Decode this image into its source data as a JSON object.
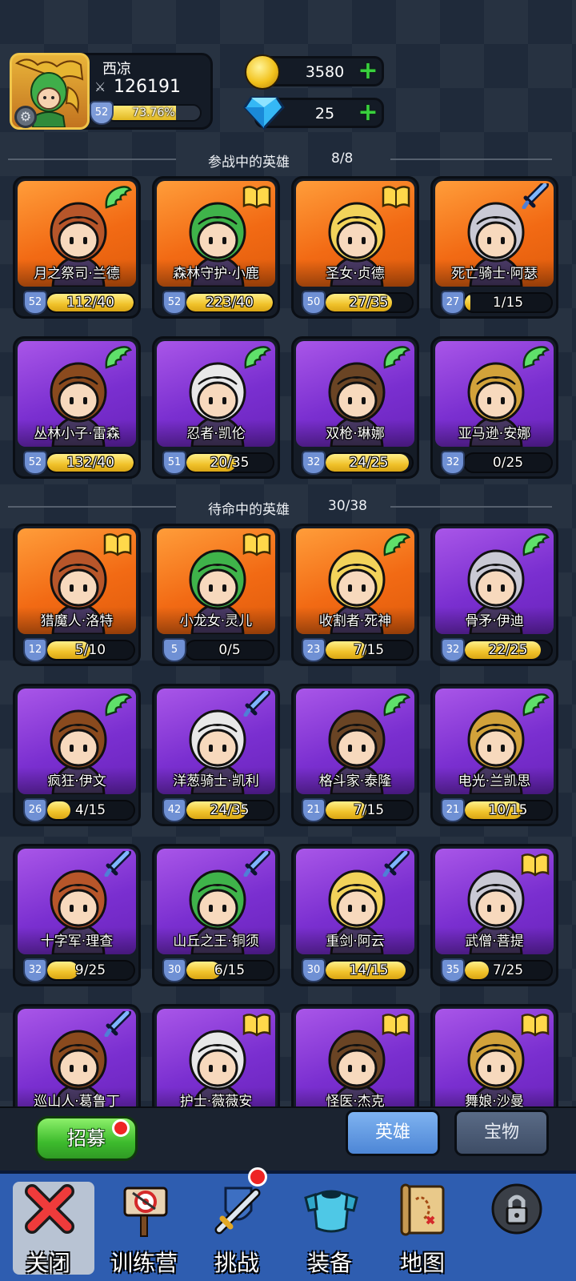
{
  "player": {
    "name": "西凉",
    "power": "126191",
    "level": "52",
    "exp_text": "73.76%",
    "exp_fraction": 0.7376
  },
  "resources": {
    "gold": "3580",
    "gems": "25"
  },
  "sections": {
    "active": {
      "title": "参战中的英雄",
      "count": "8/8"
    },
    "standby": {
      "title": "待命中的英雄",
      "count": "30/38"
    }
  },
  "active_heroes": [
    {
      "name": "月之祭司·兰德",
      "level": "52",
      "progress": "112/40",
      "fill": 1.0,
      "rarity": "orange",
      "type": "wing-icon"
    },
    {
      "name": "森林守护·小鹿",
      "level": "52",
      "progress": "223/40",
      "fill": 1.0,
      "rarity": "orange",
      "type": "book-icon"
    },
    {
      "name": "圣女·贞德",
      "level": "50",
      "progress": "27/35",
      "fill": 0.77,
      "rarity": "orange",
      "type": "book-icon"
    },
    {
      "name": "死亡骑士·阿瑟",
      "level": "27",
      "progress": "1/15",
      "fill": 0.067,
      "rarity": "orange",
      "type": "sword-icon"
    },
    {
      "name": "丛林小子·雷森",
      "level": "52",
      "progress": "132/40",
      "fill": 1.0,
      "rarity": "purple",
      "type": "wing-icon"
    },
    {
      "name": "忍者·凯伦",
      "level": "51",
      "progress": "20/35",
      "fill": 0.57,
      "rarity": "purple",
      "type": "wing-icon"
    },
    {
      "name": "双枪·琳娜",
      "level": "32",
      "progress": "24/25",
      "fill": 0.96,
      "rarity": "purple",
      "type": "wing-icon"
    },
    {
      "name": "亚马逊·安娜",
      "level": "32",
      "progress": "0/25",
      "fill": 0.0,
      "rarity": "purple",
      "type": "wing-icon"
    }
  ],
  "standby_heroes": [
    {
      "name": "猎魔人·洛特",
      "level": "12",
      "progress": "5/10",
      "fill": 0.5,
      "rarity": "orange",
      "type": "book-icon"
    },
    {
      "name": "小龙女·灵儿",
      "level": "5",
      "progress": "0/5",
      "fill": 0.0,
      "rarity": "orange",
      "type": "book-icon"
    },
    {
      "name": "收割者·死神",
      "level": "23",
      "progress": "7/15",
      "fill": 0.47,
      "rarity": "orange",
      "type": "wing-icon"
    },
    {
      "name": "骨矛·伊迪",
      "level": "32",
      "progress": "22/25",
      "fill": 0.88,
      "rarity": "purple",
      "type": "wing-icon"
    },
    {
      "name": "疯狂·伊文",
      "level": "26",
      "progress": "4/15",
      "fill": 0.27,
      "rarity": "purple",
      "type": "wing-icon"
    },
    {
      "name": "洋葱骑士·凯利",
      "level": "42",
      "progress": "24/35",
      "fill": 0.69,
      "rarity": "purple",
      "type": "sword-icon"
    },
    {
      "name": "格斗家·泰隆",
      "level": "21",
      "progress": "7/15",
      "fill": 0.47,
      "rarity": "purple",
      "type": "wing-icon"
    },
    {
      "name": "电光·兰凯思",
      "level": "21",
      "progress": "10/15",
      "fill": 0.67,
      "rarity": "purple",
      "type": "wing-icon"
    },
    {
      "name": "十字军·理查",
      "level": "32",
      "progress": "9/25",
      "fill": 0.36,
      "rarity": "purple",
      "type": "sword-icon"
    },
    {
      "name": "山丘之王·铜须",
      "level": "30",
      "progress": "6/15",
      "fill": 0.4,
      "rarity": "purple",
      "type": "sword-icon"
    },
    {
      "name": "重剑·阿云",
      "level": "30",
      "progress": "14/15",
      "fill": 0.93,
      "rarity": "purple",
      "type": "sword-icon"
    },
    {
      "name": "武僧·菩提",
      "level": "35",
      "progress": "7/25",
      "fill": 0.28,
      "rarity": "purple",
      "type": "book-icon"
    },
    {
      "name": "巡山人·葛鲁丁",
      "level": "",
      "progress": "",
      "fill": 0,
      "rarity": "purple",
      "type": "sword-icon"
    },
    {
      "name": "护士·薇薇安",
      "level": "",
      "progress": "",
      "fill": 0,
      "rarity": "purple",
      "type": "book-icon"
    },
    {
      "name": "怪医·杰克",
      "level": "",
      "progress": "",
      "fill": 0,
      "rarity": "purple",
      "type": "book-icon"
    },
    {
      "name": "舞娘·沙曼",
      "level": "",
      "progress": "",
      "fill": 0,
      "rarity": "purple",
      "type": "book-icon"
    }
  ],
  "actions": {
    "recruit_label": "招募",
    "tab_heroes": "英雄",
    "tab_treasure": "宝物"
  },
  "nav": {
    "close": "关闭",
    "training": "训练营",
    "challenge": "挑战",
    "equipment": "装备",
    "map": "地图"
  },
  "colors": {
    "orange_card": "#f26a14",
    "purple_card": "#7a2fd0",
    "progress_fill": "#f0c22a",
    "nav_bar": "#2e5db0",
    "recruit_green": "#3dbb2d"
  }
}
